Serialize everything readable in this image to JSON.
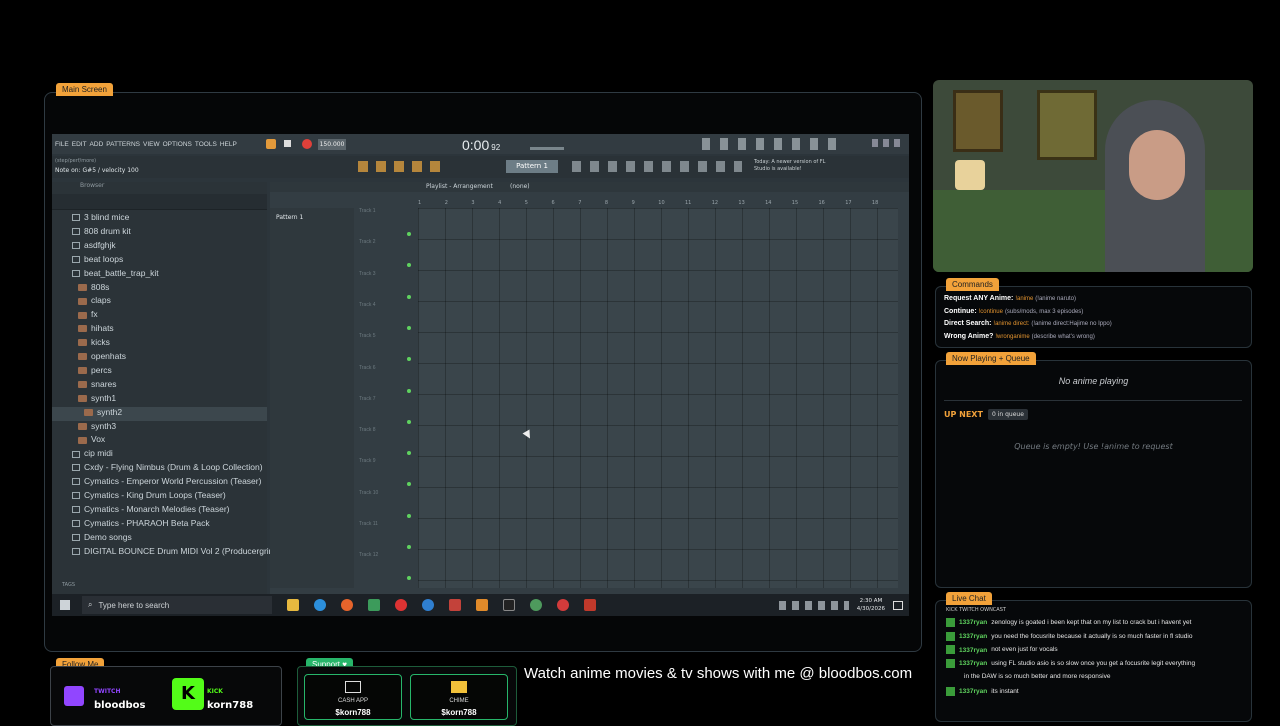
{
  "main_tag": "Main Screen",
  "fl": {
    "menu": [
      "FILE",
      "EDIT",
      "ADD",
      "PATTERNS",
      "VIEW",
      "OPTIONS",
      "TOOLS",
      "HELP"
    ],
    "tempo": "150.000",
    "time": "0:00",
    "time_small": "92",
    "hint_top": "(step/perf/more)",
    "hint_note": "Note on: G#5 / velocity 100",
    "pattern_label": "Pattern 1",
    "update_note": "Today: A newer version of FL Studio is available!",
    "browser_label": "Browser",
    "playlist_title": "Playlist - Arrangement",
    "playlist_none": "(none)",
    "pattern_list_item": "Pattern 1",
    "browser_items": [
      {
        "label": "3 blind mice",
        "type": "folder",
        "indent": 0
      },
      {
        "label": "808 drum kit",
        "type": "folder",
        "indent": 0
      },
      {
        "label": "asdfghjk",
        "type": "folder",
        "indent": 0
      },
      {
        "label": "beat loops",
        "type": "folder",
        "indent": 0
      },
      {
        "label": "beat_battle_trap_kit",
        "type": "folder-open",
        "indent": 0
      },
      {
        "label": "808s",
        "type": "sub",
        "indent": 1
      },
      {
        "label": "claps",
        "type": "sub",
        "indent": 1
      },
      {
        "label": "fx",
        "type": "sub",
        "indent": 1
      },
      {
        "label": "hihats",
        "type": "sub",
        "indent": 1
      },
      {
        "label": "kicks",
        "type": "sub",
        "indent": 1
      },
      {
        "label": "openhats",
        "type": "sub",
        "indent": 1
      },
      {
        "label": "percs",
        "type": "sub",
        "indent": 1
      },
      {
        "label": "snares",
        "type": "sub",
        "indent": 1
      },
      {
        "label": "synth1",
        "type": "sub",
        "indent": 1
      },
      {
        "label": "synth2",
        "type": "sub",
        "indent": 2
      },
      {
        "label": "synth3",
        "type": "sub",
        "indent": 1
      },
      {
        "label": "Vox",
        "type": "sub",
        "indent": 1
      },
      {
        "label": "cip midi",
        "type": "folder",
        "indent": 0
      },
      {
        "label": "Cxdy - Flying Nimbus (Drum & Loop Collection)",
        "type": "folder",
        "indent": 0
      },
      {
        "label": "Cymatics - Emperor World Percussion (Teaser)",
        "type": "folder",
        "indent": 0
      },
      {
        "label": "Cymatics - King Drum Loops (Teaser)",
        "type": "folder",
        "indent": 0
      },
      {
        "label": "Cymatics - Monarch Melodies (Teaser)",
        "type": "folder",
        "indent": 0
      },
      {
        "label": "Cymatics - PHARAOH Beta Pack",
        "type": "folder",
        "indent": 0
      },
      {
        "label": "Demo songs",
        "type": "folder",
        "indent": 0
      },
      {
        "label": "DIGITAL BOUNCE Drum MIDI Vol 2 (Producergrind)",
        "type": "folder",
        "indent": 0
      }
    ],
    "tracks": [
      "Track 1",
      "Track 2",
      "Track 3",
      "Track 4",
      "Track 5",
      "Track 6",
      "Track 7",
      "Track 8",
      "Track 9",
      "Track 10",
      "Track 11",
      "Track 12"
    ],
    "bars": [
      "1",
      "2",
      "3",
      "4",
      "5",
      "6",
      "7",
      "8",
      "9",
      "10",
      "11",
      "12",
      "13",
      "14",
      "15",
      "16",
      "17",
      "18"
    ],
    "tags_label": "TAGS"
  },
  "taskbar": {
    "search_placeholder": "Type here to search",
    "time": "2:30 AM",
    "date": "4/30/2026"
  },
  "commands": {
    "tag": "Commands",
    "rows": [
      {
        "label": "Request ANY Anime:",
        "cmd": "!anime",
        "desc": "(!anime naruto)"
      },
      {
        "label": "Continue:",
        "cmd": "!continue",
        "desc": "(subs/mods, max 3 episodes)"
      },
      {
        "label": "Direct Search:",
        "cmd": "!anime direct:",
        "desc": "(!anime direct:Hajime no Ippo)"
      },
      {
        "label": "Wrong Anime?",
        "cmd": "!wronganime",
        "desc": "(describe what's wrong)"
      }
    ]
  },
  "now_playing": {
    "tag": "Now Playing + Queue",
    "status": "No anime playing",
    "up_next": "UP NEXT",
    "queue_count": "0 in queue",
    "queue_empty": "Queue is empty! Use !anime to request"
  },
  "live_chat": {
    "tag": "Live Chat",
    "platforms": "KICK  TWITCH  OWNCAST",
    "messages": [
      {
        "user": "1337ryan",
        "text": "zenology is goated i been kept that on my list to crack but i havent yet"
      },
      {
        "user": "1337ryan",
        "text": "you need the focusrite because it actually is so much faster in fl studio"
      },
      {
        "user": "1337ryan",
        "text": "not even just for vocals"
      },
      {
        "user": "1337ryan",
        "text": "using FL studio asio is so slow once you get a focusrite legit everything"
      },
      {
        "user": "",
        "text": "in the DAW is so much better and more responsive"
      },
      {
        "user": "1337ryan",
        "text": "its instant"
      }
    ]
  },
  "follow": {
    "tag": "Follow Me",
    "twitch_label": "TWITCH",
    "twitch_name": "bloodbos",
    "kick_label": "KICK",
    "kick_name": "korn788"
  },
  "support": {
    "tag": "Support",
    "cashapp_label": "CASH APP",
    "cashapp_handle": "$korn788",
    "chime_label": "CHIME",
    "chime_handle": "$korn788"
  },
  "banner": "Watch anime movies & tv shows with me @ bloodbos.com",
  "colors": {
    "accent": "#f2a23a",
    "green": "#27b56a",
    "twitch": "#9146ff",
    "kick": "#53fc18"
  }
}
